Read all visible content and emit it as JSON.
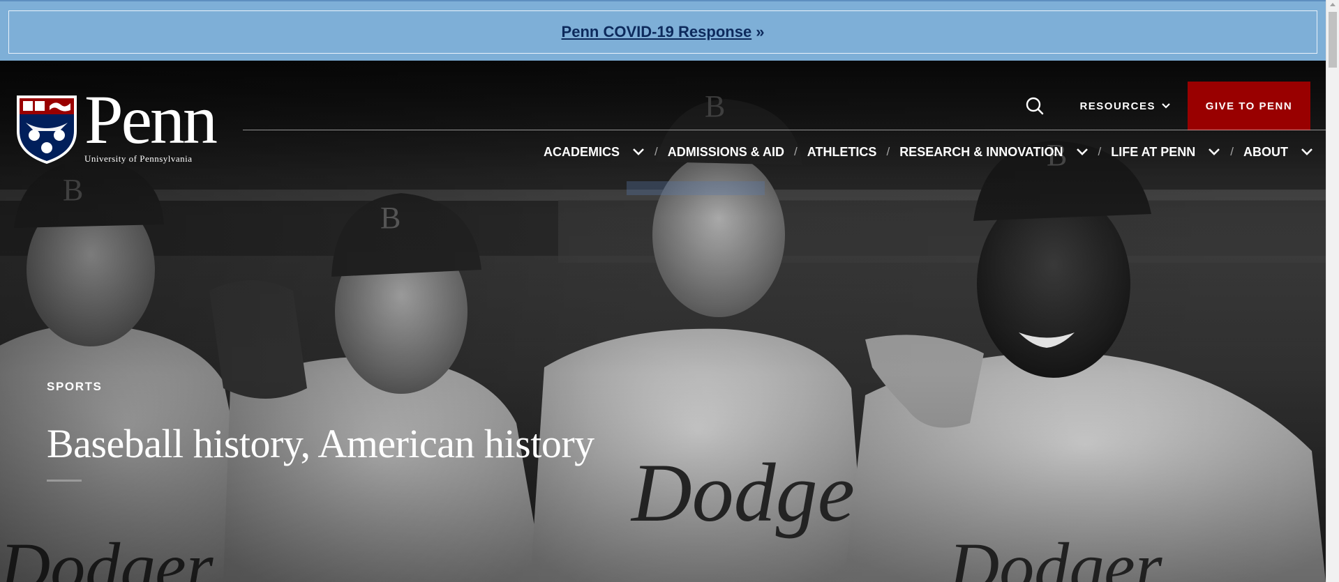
{
  "alert": {
    "link_text": "Penn COVID-19 Response",
    "suffix": "»"
  },
  "logo": {
    "wordmark": "Penn",
    "subtitle": "University of Pennsylvania"
  },
  "utility_nav": {
    "search_icon": "search-icon",
    "resources_label": "RESOURCES",
    "give_label": "GIVE TO PENN"
  },
  "main_nav": {
    "separator": "/",
    "items": [
      {
        "label": "ACADEMICS",
        "has_dropdown": true
      },
      {
        "label": "ADMISSIONS & AID",
        "has_dropdown": false
      },
      {
        "label": "ATHLETICS",
        "has_dropdown": false
      },
      {
        "label": "RESEARCH & INNOVATION",
        "has_dropdown": true
      },
      {
        "label": "LIFE AT PENN",
        "has_dropdown": true
      },
      {
        "label": "ABOUT",
        "has_dropdown": true
      }
    ]
  },
  "hero": {
    "category": "SPORTS",
    "title": "Baseball history, American history"
  },
  "colors": {
    "alert_bg": "#7eafd7",
    "alert_text": "#0d2a5c",
    "give_bg": "#990000",
    "shield_blue": "#011f5b",
    "shield_red": "#990000"
  }
}
